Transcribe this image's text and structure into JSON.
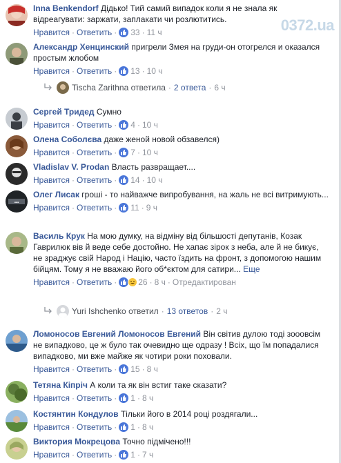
{
  "watermark": "0372.ua",
  "actions": {
    "like": "Нравится",
    "reply": "Ответить",
    "sep": "·",
    "edited": "Отредактирован",
    "more": "Еще"
  },
  "comments": [
    {
      "author": "Inna Benkendorf",
      "text": "Дідько! Тий самий випадок коли я не знала як відреагувати: заржати, заплакати чи розлютитись.",
      "likes": "33",
      "time": "11 ч",
      "avatar_color": "#c9302c"
    },
    {
      "author": "Александр Хенцинский",
      "text": "пригрели Змея на груди-он отогрелся и оказался простым жлобом",
      "likes": "13",
      "time": "10 ч",
      "avatar_color": "#6d7a5a"
    },
    {
      "author": "Сергей Тридед",
      "text": "Сумно",
      "likes": "4",
      "time": "10 ч",
      "avatar_color": "#3b3f45"
    },
    {
      "author": "Олена Соболєва",
      "text": "даже женой новой обзавелся)",
      "likes": "7",
      "time": "10 ч",
      "avatar_color": "#8a5a3a"
    },
    {
      "author": "Vladislav V. Prodan",
      "text": "Власть развращает....",
      "likes": "14",
      "time": "10 ч",
      "avatar_color": "#2a2a2a"
    },
    {
      "author": "Олег Лисак",
      "text": "гроші - то найважче випробування, на жаль не всі витримують...",
      "likes": "11",
      "time": "9 ч",
      "avatar_color": "#1f2326"
    },
    {
      "author": "Василь Крук",
      "text": "На мою думку, на відміну від більшості депутанів, Козак Гаврилюк вів й веде себе достойно. Не хапає зірок з неба, але й не бикує, не зраджує свій Народ і Націю, часто їздить на фронт, з допомогою нашим бійцям. Тому я не вважаю його об*єктом для сатири...",
      "likes": "26",
      "time": "8 ч",
      "avatar_color": "#7a8f5a"
    },
    {
      "author": "Ломоносов Евгений Ломоносов Евгений",
      "text": "Він світив дулою тоді зооовсім не випадково, це ж було так очевидно ще одразу ! Всіх, що їм попадалися випадково, ми вже майже як чотири роки поховали.",
      "likes": "15",
      "time": "8 ч",
      "avatar_color": "#2e5a8a"
    },
    {
      "author": "Тетяна Кіпріч",
      "text": "А коли та як він встиг таке сказати?",
      "likes": "1",
      "time": "8 ч",
      "avatar_color": "#5a7a3a"
    },
    {
      "author": "Костянтин Кондулов",
      "text": "Тільки його в 2014 році роздягали...",
      "likes": "1",
      "time": "8 ч",
      "avatar_color": "#6a8a4a"
    },
    {
      "author": "Виктория Мокрецова",
      "text": "Точно підмічено!!!",
      "likes": "1",
      "time": "7 ч",
      "avatar_color": "#9aa860"
    }
  ],
  "replies": [
    {
      "name": "Tischa Zarithna",
      "verb": "ответила",
      "count": "2 ответа",
      "time": "6 ч",
      "avatar_color": "#7a6a4a"
    },
    {
      "name": "Yuri Ishchenko",
      "verb": "ответил",
      "count": "13 ответов",
      "time": "2 ч",
      "avatar_color": "#d6d8dc"
    }
  ]
}
